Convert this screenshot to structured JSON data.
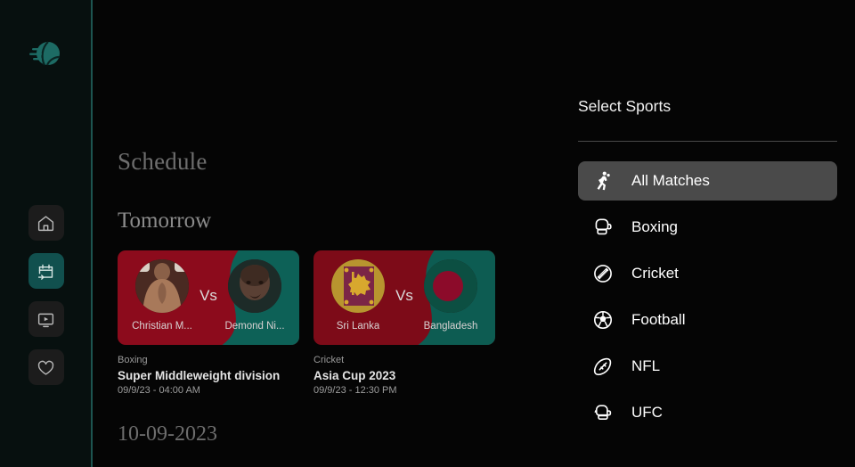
{
  "brand": {
    "logo_icon": "tennis-ball-motion-icon",
    "accent_color": "#11504e",
    "logo_color": "#1d6b64"
  },
  "sidebar": {
    "items": [
      {
        "id": "home",
        "icon": "home-icon",
        "active": false
      },
      {
        "id": "schedule",
        "icon": "calendar-arrow-icon",
        "active": true
      },
      {
        "id": "live-tv",
        "icon": "tv-play-icon",
        "active": false
      },
      {
        "id": "favorites",
        "icon": "heart-icon",
        "active": false
      }
    ]
  },
  "schedule": {
    "heading": "Schedule",
    "day_label": "Tomorrow",
    "next_date_label": "10-09-2023",
    "vs_label": "Vs",
    "cards": [
      {
        "sport": "Boxing",
        "title": "Super Middleweight division",
        "time": "09/9/23 - 04:00 AM",
        "left": {
          "name": "Christian M...",
          "avatar": "boxer-portrait",
          "bg_color": "#8c0b1c"
        },
        "right": {
          "name": "Demond Ni...",
          "avatar": "boxer-portrait",
          "bg_color": "#0d6157"
        }
      },
      {
        "sport": "Cricket",
        "title": "Asia Cup 2023",
        "time": "09/9/23 - 12:30 PM",
        "left": {
          "name": "Sri Lanka",
          "avatar": "sri-lanka-flag",
          "bg_color": "#7d0b18"
        },
        "right": {
          "name": "Bangladesh",
          "avatar": "bangladesh-flag",
          "bg_color": "#0d5c52"
        }
      }
    ]
  },
  "sports_panel": {
    "title": "Select Sports",
    "items": [
      {
        "label": "All Matches",
        "icon": "handball-player-icon",
        "selected": true
      },
      {
        "label": "Boxing",
        "icon": "boxing-glove-icon",
        "selected": false
      },
      {
        "label": "Cricket",
        "icon": "cricket-ball-icon",
        "selected": false
      },
      {
        "label": "Football",
        "icon": "soccer-ball-icon",
        "selected": false
      },
      {
        "label": "NFL",
        "icon": "american-football-icon",
        "selected": false
      },
      {
        "label": "UFC",
        "icon": "mma-glove-icon",
        "selected": false
      }
    ]
  }
}
